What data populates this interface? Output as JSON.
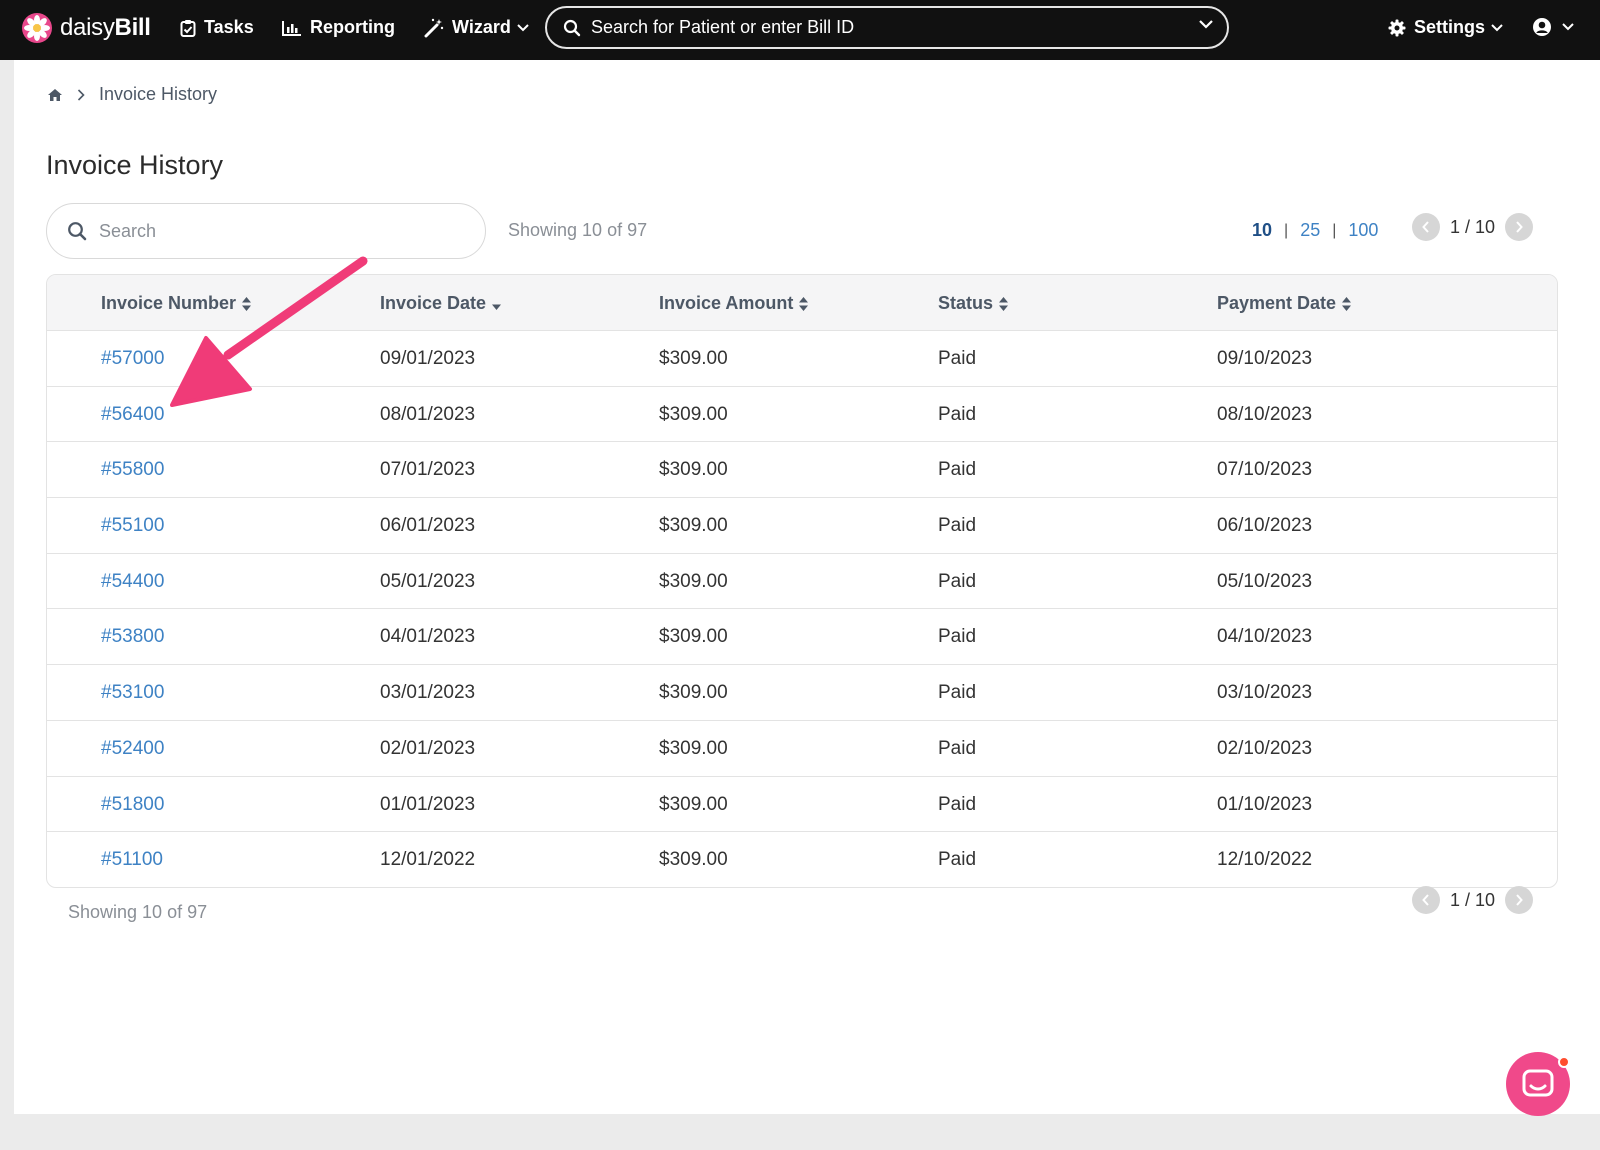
{
  "brand": {
    "name_light": "daisy",
    "name_bold": "Bill"
  },
  "nav": {
    "tasks": "Tasks",
    "reporting": "Reporting",
    "wizard": "Wizard",
    "search_placeholder": "Search for Patient or enter Bill ID",
    "settings": "Settings"
  },
  "breadcrumb": {
    "current": "Invoice History"
  },
  "page": {
    "title": "Invoice History",
    "search_placeholder": "Search",
    "showing": "Showing 10 of 97",
    "page_sizes": [
      "10",
      "25",
      "100"
    ],
    "pagination": "1 / 10"
  },
  "table": {
    "headers": [
      "Invoice Number",
      "Invoice Date",
      "Invoice Amount",
      "Status",
      "Payment Date"
    ],
    "rows": [
      [
        "#57000",
        "09/01/2023",
        "$309.00",
        "Paid",
        "09/10/2023"
      ],
      [
        "#56400",
        "08/01/2023",
        "$309.00",
        "Paid",
        "08/10/2023"
      ],
      [
        "#55800",
        "07/01/2023",
        "$309.00",
        "Paid",
        "07/10/2023"
      ],
      [
        "#55100",
        "06/01/2023",
        "$309.00",
        "Paid",
        "06/10/2023"
      ],
      [
        "#54400",
        "05/01/2023",
        "$309.00",
        "Paid",
        "05/10/2023"
      ],
      [
        "#53800",
        "04/01/2023",
        "$309.00",
        "Paid",
        "04/10/2023"
      ],
      [
        "#53100",
        "03/01/2023",
        "$309.00",
        "Paid",
        "03/10/2023"
      ],
      [
        "#52400",
        "02/01/2023",
        "$309.00",
        "Paid",
        "02/10/2023"
      ],
      [
        "#51800",
        "01/01/2023",
        "$309.00",
        "Paid",
        "01/10/2023"
      ],
      [
        "#51100",
        "12/01/2022",
        "$309.00",
        "Paid",
        "12/10/2022"
      ]
    ]
  },
  "colors": {
    "link": "#3e82c4",
    "accent_pink": "#f0498a",
    "nav_bg": "#111111"
  },
  "icons": [
    "daisy-logo-icon",
    "clipboard-check-icon",
    "bar-chart-icon",
    "magic-wand-icon",
    "search-icon",
    "chevron-down-icon",
    "gear-icon",
    "user-circle-icon",
    "home-icon",
    "chevron-right-icon",
    "sort-icon",
    "sort-desc-icon",
    "chevron-left-icon",
    "chat-icon"
  ]
}
